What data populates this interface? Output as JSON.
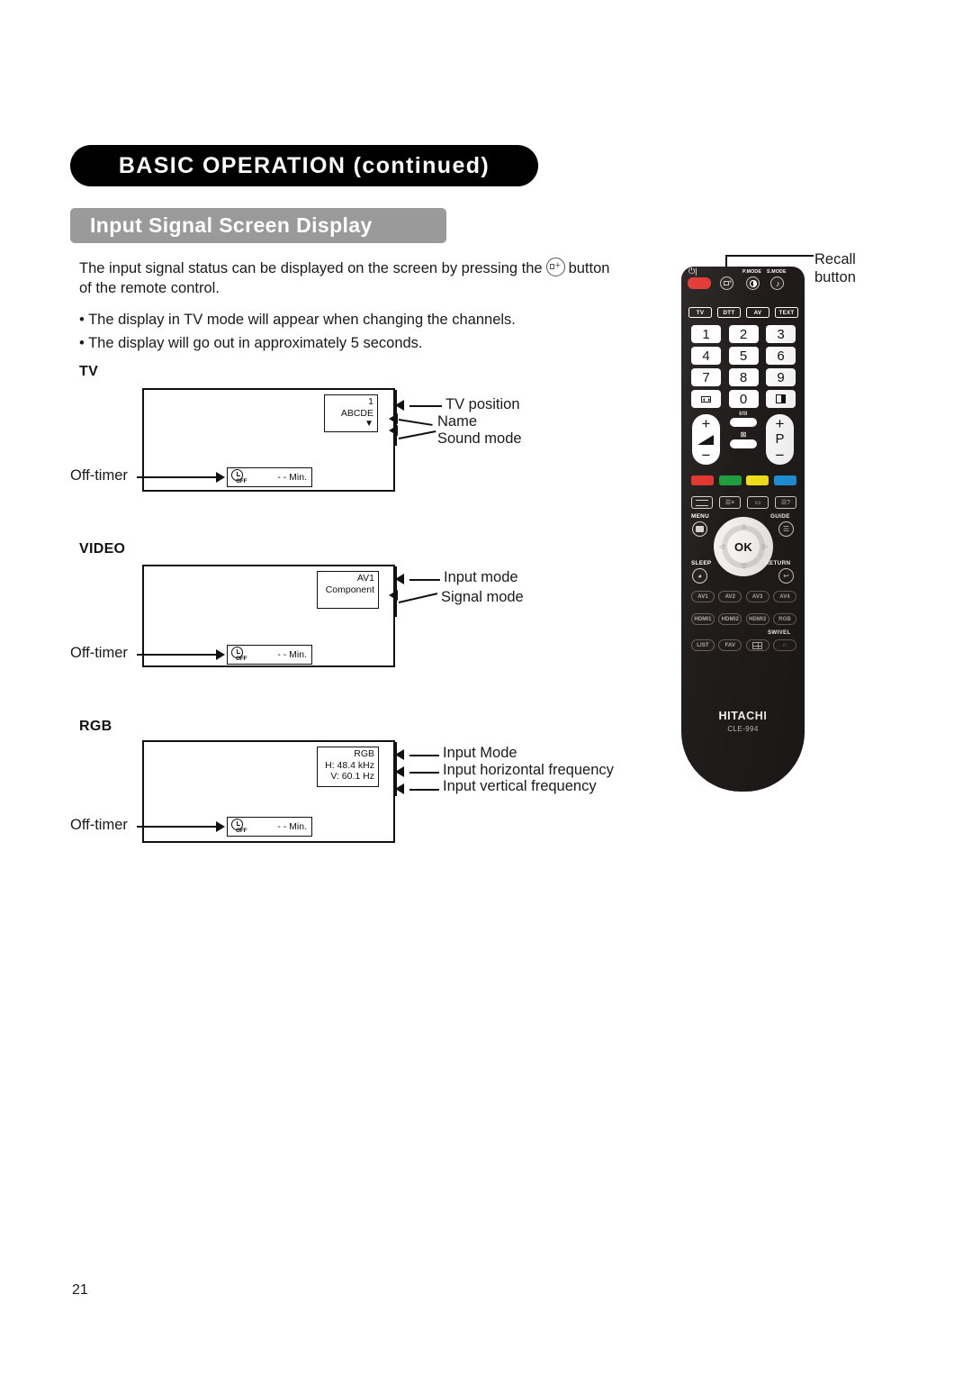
{
  "header": {
    "banner_title": "BASIC OPERATION (continued)",
    "section_title": "Input Signal Screen Display"
  },
  "intro": {
    "line1_before_icon": "The input signal status can be displayed on the screen by pressing the",
    "recall_icon": "recall-icon",
    "line1_after_icon": "button",
    "line2": "of the remote control.",
    "bullets": [
      "• The display in TV mode will appear when changing the channels.",
      "• The display will go out in approximately 5 seconds."
    ]
  },
  "diagrams": {
    "tv": {
      "label": "TV",
      "osd": {
        "position": "1",
        "name": "ABCDE",
        "sound_mode": "▼"
      },
      "callouts": [
        "TV position",
        "Name",
        "Sound mode"
      ],
      "offtimer_caption": "Off-timer",
      "offtimer_value": "- -  Min.",
      "offtimer_icon_label": "OFF"
    },
    "video": {
      "label": "VIDEO",
      "osd": {
        "input_mode": "AV1",
        "signal_mode": "Component"
      },
      "callouts": [
        "Input mode",
        "Signal mode"
      ],
      "offtimer_caption": "Off-timer",
      "offtimer_value": "- -  Min.",
      "offtimer_icon_label": "OFF"
    },
    "rgb": {
      "label": "RGB",
      "osd": {
        "input_mode": "RGB",
        "h_freq": "H: 48.4 kHz",
        "v_freq": "V: 60.1   Hz"
      },
      "callouts": [
        "Input Mode",
        "Input horizontal frequency",
        "Input vertical frequency"
      ],
      "offtimer_caption": "Off-timer",
      "offtimer_value": "- -  Min.",
      "offtimer_icon_label": "OFF"
    }
  },
  "remote": {
    "callout": "Recall\nbutton",
    "callout_line1": "Recall",
    "callout_line2": "button",
    "power_symbol": "⏻|",
    "top_labels": {
      "pmode": "P.MODE",
      "smode": "S.MODE"
    },
    "source_buttons": [
      "TV",
      "DTT",
      "AV",
      "TEXT"
    ],
    "numpad": [
      "1",
      "2",
      "3",
      "4",
      "5",
      "6",
      "7",
      "8",
      "9",
      "swap-icon",
      "0",
      "half-screen-icon"
    ],
    "numpad_zero_row": {
      "left_icon": "swap-icon",
      "zero": "0",
      "right_icon": "half-screen-icon"
    },
    "volume": {
      "plus": "+",
      "minus": "−"
    },
    "program": {
      "plus": "+",
      "letter": "P",
      "minus": "−"
    },
    "ii_label": "I/II",
    "mute_glyph": "⊠",
    "color_keys": [
      "#e0342c",
      "#1f9e3e",
      "#f5e21a",
      "#2196e0"
    ],
    "teletext_labels": [
      "text-index-icon",
      "text-cancel-icon",
      "subtitle-icon",
      "text-reveal-icon"
    ],
    "menu_label": "MENU",
    "guide_label": "GUIDE",
    "sleep_label": "SLEEP",
    "return_label": "RETURN",
    "ok_label": "OK",
    "dpad": {
      "up": "△",
      "down": "▽",
      "left": "◁",
      "right": "▷"
    },
    "pill_row_1": [
      "AV1",
      "AV2",
      "AV3",
      "AV4"
    ],
    "pill_row_2": [
      "HDMI1",
      "HDMI2",
      "HDMI3",
      "RGB"
    ],
    "pill_row_3": [
      "LIST",
      "FAV",
      "grid-icon",
      "headphone-icon"
    ],
    "swivel_label": "SWIVEL",
    "brand": "HITACHI",
    "model": "CLE-994"
  },
  "footer": {
    "page_number": "21"
  }
}
